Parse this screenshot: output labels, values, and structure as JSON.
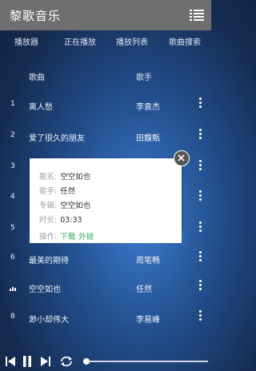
{
  "app": {
    "title": "黎歌音乐"
  },
  "tabs": [
    "播放器",
    "正在播放",
    "播放列表",
    "歌曲搜索"
  ],
  "list_header": {
    "song": "歌曲",
    "artist": "歌手"
  },
  "songs": [
    {
      "num": "1",
      "title": "离人愁",
      "artist": "李袁杰"
    },
    {
      "num": "2",
      "title": "爱了很久的朋友",
      "artist": "田馥甄"
    },
    {
      "num": "3",
      "title": "",
      "artist": ""
    },
    {
      "num": "4",
      "title": "",
      "artist": ""
    },
    {
      "num": "5",
      "title": "",
      "artist": ""
    },
    {
      "num": "6",
      "title": "最美的期待",
      "artist": "周笔畅"
    },
    {
      "num": "",
      "title": "空空如也",
      "artist": "任然",
      "playing": true
    },
    {
      "num": "8",
      "title": "渺小却伟大",
      "artist": "李易峰"
    }
  ],
  "popup": {
    "song_label": "歌名:",
    "song": "空空如也",
    "artist_label": "歌手:",
    "artist": "任然",
    "album_label": "专辑:",
    "album": "空空如也",
    "duration_label": "时长:",
    "duration": "03:33",
    "ops_label": "操作:",
    "download": "下载",
    "external": "外链"
  },
  "player": {
    "progress": 0.0
  },
  "colors": {
    "titlebar": "#6f6f6f",
    "link": "#2eaf5a",
    "accent_bg": "#23508f"
  }
}
